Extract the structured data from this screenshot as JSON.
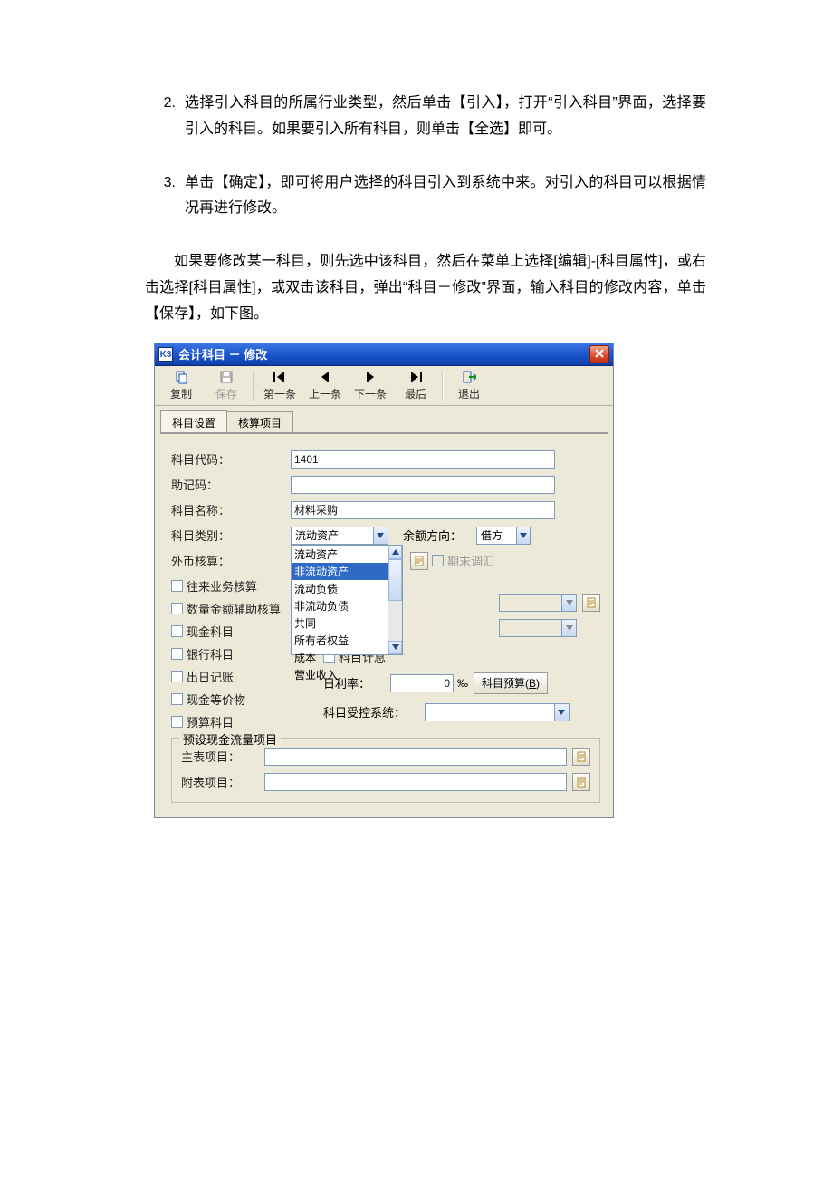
{
  "ordList": [
    {
      "num": "2.",
      "text": "选择引入科目的所属行业类型，然后单击【引入】，打开“引入科目”界面，选择要引入的科目。如果要引入所有科目，则单击【全选】即可。"
    },
    {
      "num": "3.",
      "text": "单击【确定】，即可将用户选择的科目引入到系统中来。对引入的科目可以根据情况再进行修改。"
    }
  ],
  "para1": "如果要修改某一科目，则先选中该科目，然后在菜单上选择[编辑]-[科目属性]，或右击选择[科目属性]，或双击该科目，弹出“科目－修改”界面，输入科目的修改内容，单击【保存】，如下图。",
  "win": {
    "appIconText": "K3",
    "title": "会计科目 － 修改",
    "toolbar": {
      "copy": "复制",
      "save": "保存",
      "first": "第一条",
      "prev": "上一条",
      "next": "下一条",
      "last": "最后",
      "exit": "退出"
    },
    "tabs": {
      "t1": "科目设置",
      "t2": "核算项目"
    },
    "labels": {
      "code": "科目代码：",
      "mnemonic": "助记码：",
      "name": "科目名称：",
      "category": "科目类别：",
      "balanceDir": "余额方向：",
      "fx": "外币核算：",
      "endAdj": "期末调汇",
      "chk_wanglai": "往来业务核算",
      "chk_qty": "数量金额辅助核算",
      "chk_cash": "现金科目",
      "chk_bank": "银行科目",
      "chk_journal": "出日记账",
      "chk_equiv": "现金等价物",
      "chk_budget": "预算科目",
      "chk_interest": "科目计息",
      "dailyRate": "日利率：",
      "rateUnit": "‰",
      "budgetBtn": "科目预算(",
      "budgetBtnKey": "B",
      "budgetBtnEnd": ")",
      "controlledSys": "科目受控系统：",
      "groupTitle": "预设现金流量项目",
      "mainItem": "主表项目：",
      "subItem": "附表项目："
    },
    "values": {
      "code": "1401",
      "mnemonic": "",
      "name": "材料采购",
      "category": "流动资产",
      "balanceDir": "借方",
      "dailyRate": "0"
    },
    "categoryOptions": [
      "流动资产",
      "非流动资产",
      "流动负债",
      "非流动负债",
      "共同",
      "所有者权益",
      "成本",
      "营业收入"
    ],
    "categorySelectedIndex": 1
  }
}
